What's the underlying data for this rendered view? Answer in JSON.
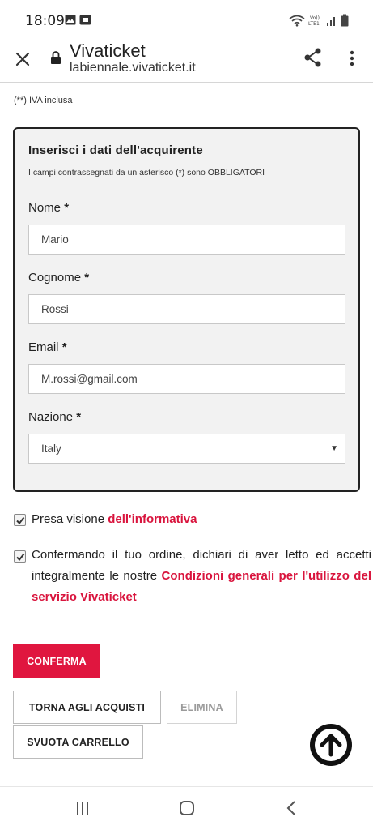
{
  "status_bar": {
    "time": "18:09",
    "icons": [
      "image-icon",
      "sim-icon",
      "wifi-icon",
      "volte-icon",
      "signal-icon",
      "battery-icon"
    ]
  },
  "browser": {
    "title": "Vivaticket",
    "url": "labiennale.vivaticket.it",
    "icons": [
      "close-icon",
      "lock-icon",
      "share-icon",
      "more-vert-icon"
    ]
  },
  "iva_note": "(**) IVA inclusa",
  "buyer_form": {
    "title": "Inserisci i dati dell'acquirente",
    "subtitle": "I campi contrassegnati da un asterisco (*) sono OBBLIGATORI",
    "nome": {
      "label": "Nome",
      "required_mark": "*",
      "value": "Mario"
    },
    "cognome": {
      "label": "Cognome",
      "required_mark": "*",
      "value": "Rossi"
    },
    "email": {
      "label": "Email",
      "required_mark": "*",
      "value": "M.rossi@gmail.com"
    },
    "nazione": {
      "label": "Nazione",
      "required_mark": "*",
      "value": "Italy"
    }
  },
  "consents": {
    "privacy": {
      "text": "Presa visione ",
      "link": "dell'informativa",
      "checked": true
    },
    "terms": {
      "text": "Confermando il tuo ordine, dichiari di aver letto ed accetti integralmente le nostre ",
      "link": "Condizioni generali per l'utilizzo del servizio Vivaticket",
      "checked": true
    }
  },
  "actions": {
    "confirm": "CONFERMA",
    "back_to_shop": "TORNA AGLI ACQUISTI",
    "delete": "ELIMINA",
    "empty_cart": "SVUOTA CARRELLO"
  },
  "colors": {
    "accent": "#e0163f",
    "link": "#d9143d",
    "panel_bg": "#f2f2f2"
  }
}
